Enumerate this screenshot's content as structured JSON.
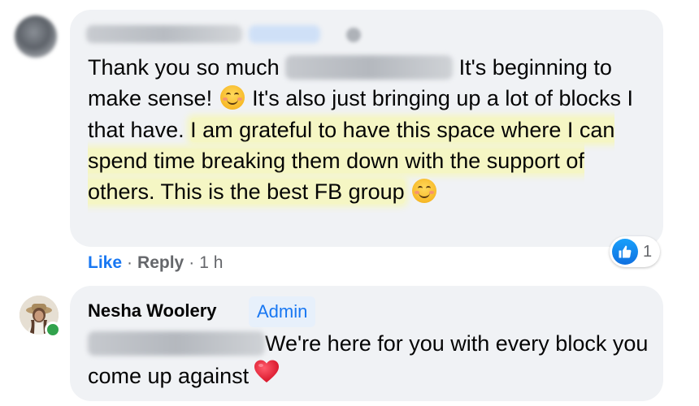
{
  "comment1": {
    "text_before_mention": "Thank you so much",
    "text_after_mention": " It's beginning to make sense!",
    "text_after_emoji": " It's also just bringing up a lot of blocks I that have. ",
    "highlighted_text": "I am grateful to have this space where I can spend time breaking them down with the support of others. This is the best FB group",
    "emoji_1": "smiling-face-icon",
    "emoji_2": "smiling-face-icon",
    "actions": {
      "like_label": "Like",
      "reply_label": "Reply",
      "separator": "·",
      "time": "1 h"
    },
    "reaction": {
      "icon": "like-icon",
      "count": "1"
    }
  },
  "comment2": {
    "author": "Nesha Woolery",
    "badge": "Admin",
    "text": "We're here for you with every block you come up against",
    "emoji": "red-heart-icon",
    "online": true
  },
  "colors": {
    "bubble": "#f0f2f5",
    "link_blue": "#1877f2",
    "meta_gray": "#65676b",
    "highlight": "#f5f6c4",
    "online_green": "#31a24c"
  }
}
